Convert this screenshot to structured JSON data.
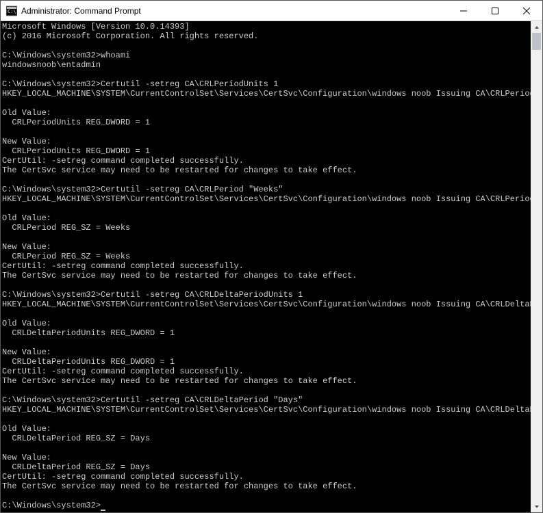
{
  "window": {
    "title": "Administrator: Command Prompt"
  },
  "console": {
    "lines": [
      "Microsoft Windows [Version 10.0.14393]",
      "(c) 2016 Microsoft Corporation. All rights reserved.",
      "",
      "C:\\Windows\\system32>whoami",
      "windowsnoob\\entadmin",
      "",
      "C:\\Windows\\system32>Certutil -setreg CA\\CRLPeriodUnits 1",
      "HKEY_LOCAL_MACHINE\\SYSTEM\\CurrentControlSet\\Services\\CertSvc\\Configuration\\windows noob Issuing CA\\CRLPeriodUnits:",
      "",
      "Old Value:",
      "  CRLPeriodUnits REG_DWORD = 1",
      "",
      "New Value:",
      "  CRLPeriodUnits REG_DWORD = 1",
      "CertUtil: -setreg command completed successfully.",
      "The CertSvc service may need to be restarted for changes to take effect.",
      "",
      "C:\\Windows\\system32>Certutil -setreg CA\\CRLPeriod \"Weeks\"",
      "HKEY_LOCAL_MACHINE\\SYSTEM\\CurrentControlSet\\Services\\CertSvc\\Configuration\\windows noob Issuing CA\\CRLPeriod:",
      "",
      "Old Value:",
      "  CRLPeriod REG_SZ = Weeks",
      "",
      "New Value:",
      "  CRLPeriod REG_SZ = Weeks",
      "CertUtil: -setreg command completed successfully.",
      "The CertSvc service may need to be restarted for changes to take effect.",
      "",
      "C:\\Windows\\system32>Certutil -setreg CA\\CRLDeltaPeriodUnits 1",
      "HKEY_LOCAL_MACHINE\\SYSTEM\\CurrentControlSet\\Services\\CertSvc\\Configuration\\windows noob Issuing CA\\CRLDeltaPeriodUnits:",
      "",
      "Old Value:",
      "  CRLDeltaPeriodUnits REG_DWORD = 1",
      "",
      "New Value:",
      "  CRLDeltaPeriodUnits REG_DWORD = 1",
      "CertUtil: -setreg command completed successfully.",
      "The CertSvc service may need to be restarted for changes to take effect.",
      "",
      "C:\\Windows\\system32>Certutil -setreg CA\\CRLDeltaPeriod \"Days\"",
      "HKEY_LOCAL_MACHINE\\SYSTEM\\CurrentControlSet\\Services\\CertSvc\\Configuration\\windows noob Issuing CA\\CRLDeltaPeriod:",
      "",
      "Old Value:",
      "  CRLDeltaPeriod REG_SZ = Days",
      "",
      "New Value:",
      "  CRLDeltaPeriod REG_SZ = Days",
      "CertUtil: -setreg command completed successfully.",
      "The CertSvc service may need to be restarted for changes to take effect.",
      "",
      "C:\\Windows\\system32>"
    ]
  }
}
